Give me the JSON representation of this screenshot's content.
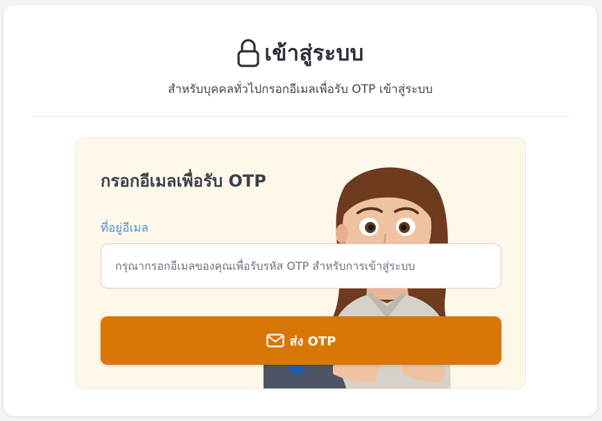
{
  "header": {
    "title": "เข้าสู่ระบบ",
    "subtitle": "สำหรับบุคคลทั่วไปกรอกอีเมลเพื่อรับ OTP เข้าสู่ระบบ",
    "icon": "lock-icon"
  },
  "form": {
    "title": "กรอกอีเมลเพื่อรับ OTP",
    "email_label": "ที่อยู่อีเมล",
    "email_value": "",
    "email_placeholder": "กรุณากรอกอีเมลของคุณเพื่อรับรหัส OTP สำหรับการเข้าสู่ระบบ",
    "submit_label": "ส่ง OTP",
    "submit_icon": "mail-icon"
  },
  "colors": {
    "accent": "#d97706",
    "label_blue": "#4f8fd6",
    "card_bg": "#fdf8e9"
  }
}
